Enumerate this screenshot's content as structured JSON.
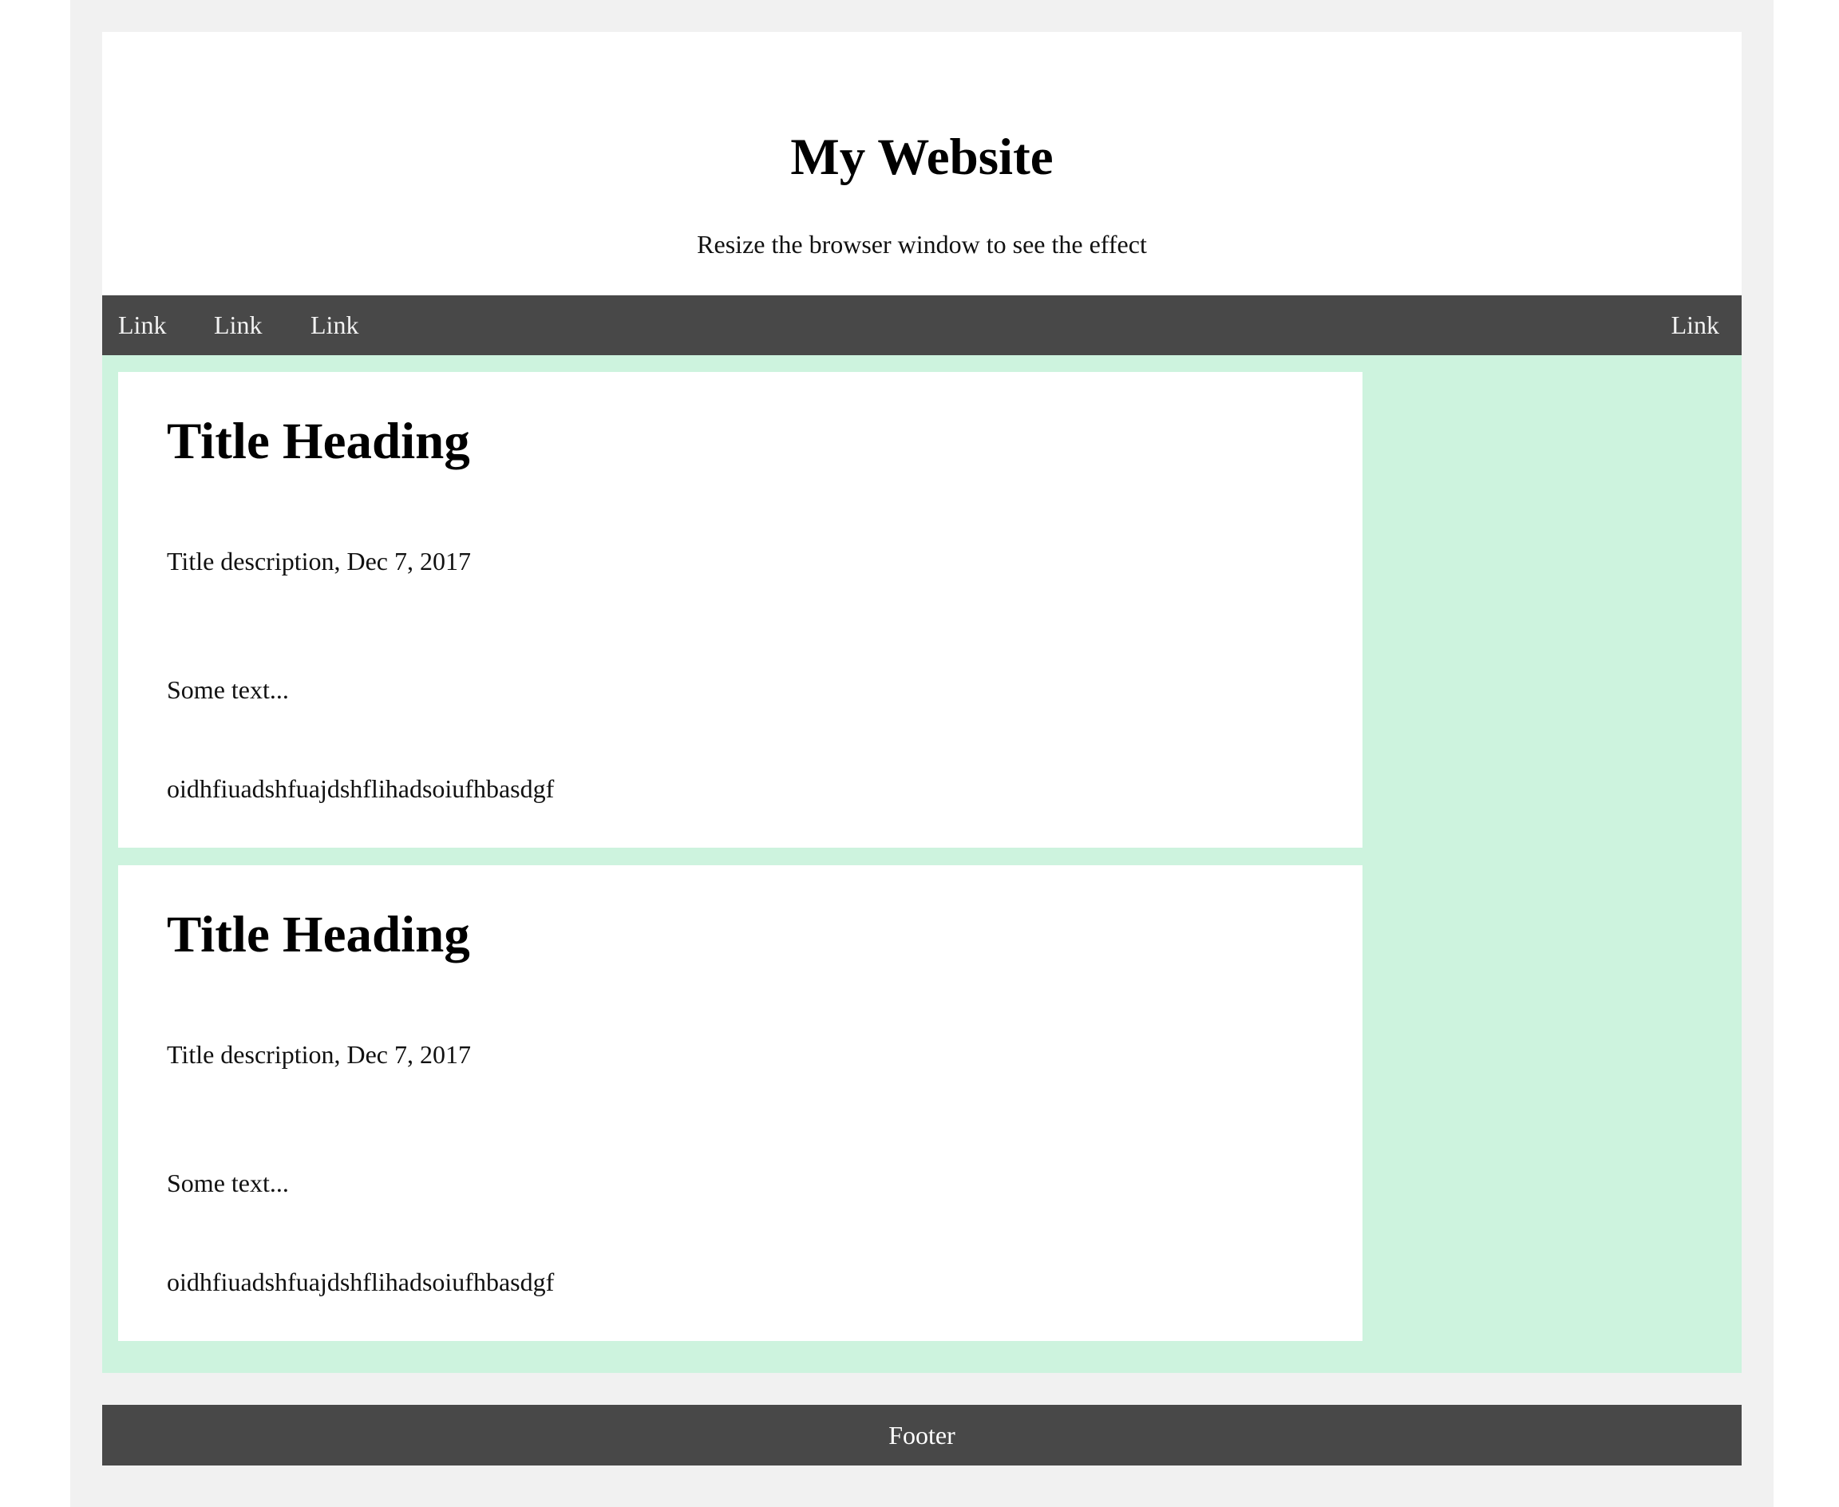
{
  "header": {
    "title": "My Website",
    "subtitle": "Resize the browser window to see the effect"
  },
  "nav": {
    "links": [
      "Link",
      "Link",
      "Link"
    ],
    "right_link": "Link"
  },
  "cards": [
    {
      "title": "Title Heading",
      "description": "Title description, Dec 7, 2017",
      "text": "Some text...",
      "extra": "oidhfiuadshfuajdshflihadsoiufhbasdgf"
    },
    {
      "title": "Title Heading",
      "description": "Title description, Dec 7, 2017",
      "text": "Some text...",
      "extra": "oidhfiuadshfuajdshflihadsoiufhbasdgf"
    }
  ],
  "footer": {
    "label": "Footer"
  },
  "colors": {
    "page_background": "#f1f1f1",
    "nav_background": "#484848",
    "main_background": "#cdf3de",
    "card_background": "#ffffff"
  }
}
